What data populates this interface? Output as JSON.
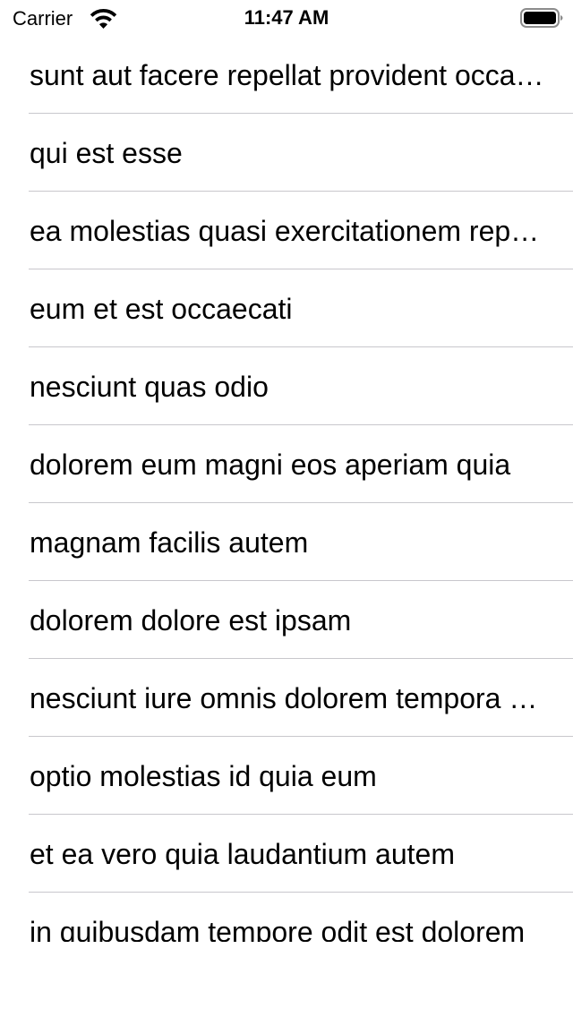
{
  "status_bar": {
    "carrier": "Carrier",
    "time": "11:47 AM",
    "wifi_icon": "wifi-icon",
    "battery_icon": "battery-full-icon"
  },
  "posts": [
    {
      "title": "sunt aut facere repellat provident occaecati excepturi optio reprehenderit"
    },
    {
      "title": "qui est esse"
    },
    {
      "title": "ea molestias quasi exercitationem repellat qui ipsa sit aut"
    },
    {
      "title": "eum et est occaecati"
    },
    {
      "title": "nesciunt quas odio"
    },
    {
      "title": "dolorem eum magni eos aperiam quia"
    },
    {
      "title": "magnam facilis autem"
    },
    {
      "title": "dolorem dolore est ipsam"
    },
    {
      "title": "nesciunt iure omnis dolorem tempora et accusantium"
    },
    {
      "title": "optio molestias id quia eum"
    },
    {
      "title": "et ea vero quia laudantium autem"
    },
    {
      "title": "in quibusdam tempore odit est dolorem"
    }
  ]
}
